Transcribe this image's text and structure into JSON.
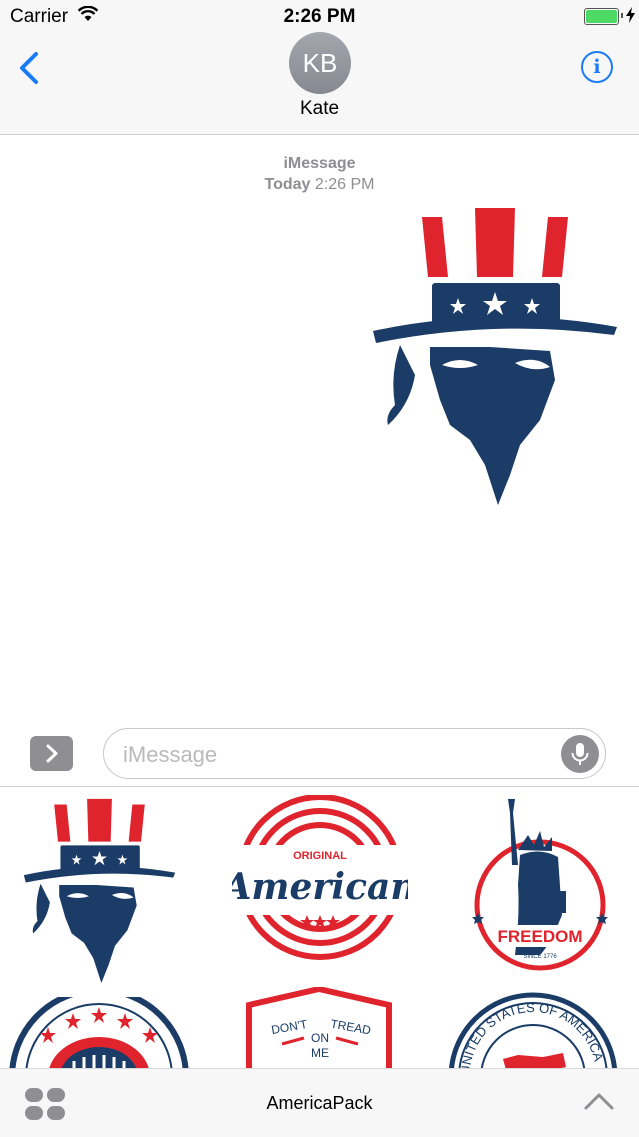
{
  "status_bar": {
    "carrier": "Carrier",
    "time": "2:26 PM",
    "battery_level": 1.0
  },
  "nav": {
    "contact_initials": "KB",
    "contact_name": "Kate",
    "info_glyph": "i"
  },
  "conversation": {
    "service_label": "iMessage",
    "day_label": "Today",
    "time_label": "2:26 PM"
  },
  "composer": {
    "placeholder": "iMessage"
  },
  "drawer": {
    "stickers": [
      {
        "name": "uncle-sam"
      },
      {
        "name": "original-american",
        "text_top": "ORIGINAL",
        "text_main": "American"
      },
      {
        "name": "freedom",
        "text_main": "FREEDOM",
        "text_sub": "SINCE 1776"
      },
      {
        "name": "capitol"
      },
      {
        "name": "dont-tread-on-me",
        "text_left": "DON'T",
        "text_right": "TREAD",
        "text_mid": "ON",
        "text_bot": "ME"
      },
      {
        "name": "united-states-of-america",
        "text_ring": "UNITED STATES OF AMERICA"
      }
    ]
  },
  "bottom_bar": {
    "pack_name": "AmericaPack"
  },
  "colors": {
    "red": "#e0242e",
    "navy": "#1a3c66",
    "ios_blue": "#1a7cf5",
    "gray": "#8e8e93"
  }
}
